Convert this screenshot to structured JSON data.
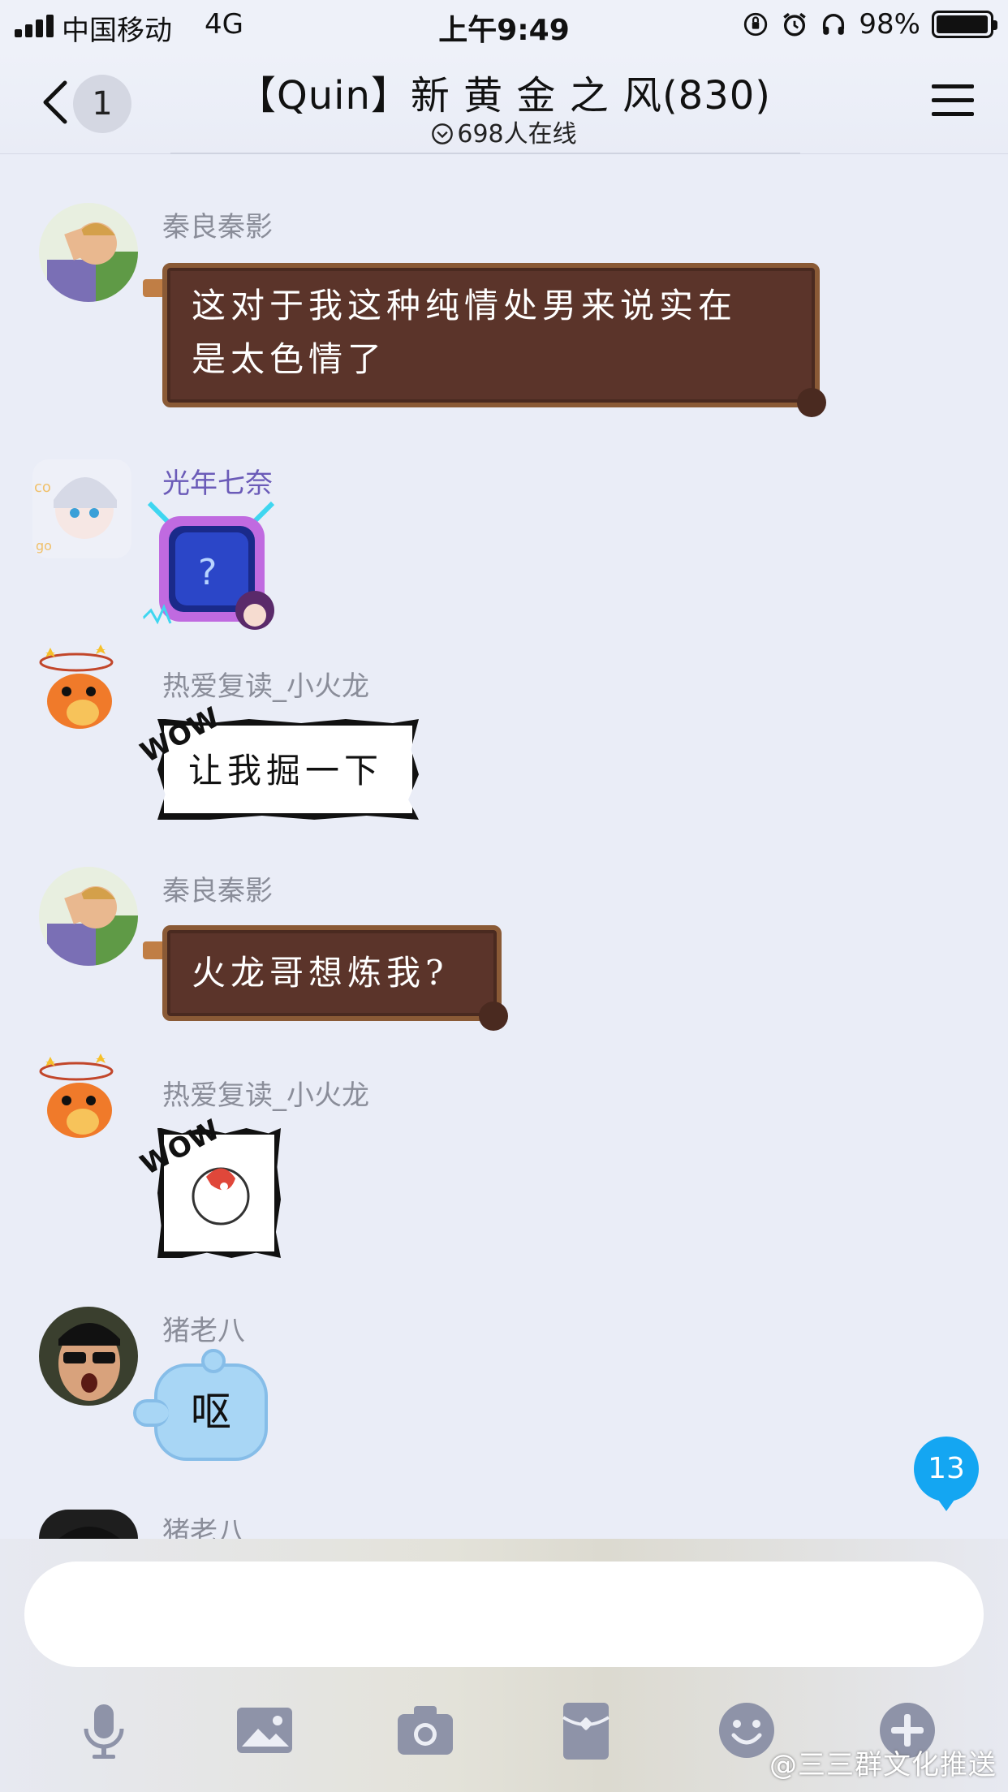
{
  "status_bar": {
    "carrier": "中国移动",
    "network": "4G",
    "time": "上午9:49",
    "battery": "98%",
    "battery_level": 0.98
  },
  "nav": {
    "unread_count": "1",
    "title": "【Quin】新 黄 金 之 风(830)",
    "online": "698人在线"
  },
  "messages": [
    {
      "sender": "秦良秦影",
      "line1": "这对于我这种纯情处男来说实在",
      "line2": "是太色情了"
    },
    {
      "sender": "光年七奈",
      "sticker": "?"
    },
    {
      "sender": "热爱复读_小火龙",
      "text": "让我掘一下",
      "tag": "WOW"
    },
    {
      "sender": "秦良秦影",
      "text": "火龙哥想炼我?"
    },
    {
      "sender": "热爱复读_小火龙",
      "tag": "WOW"
    },
    {
      "sender": "猪老八",
      "text": "呕"
    },
    {
      "sender": "猪老八"
    }
  ],
  "unread_badge": "13",
  "input": {
    "placeholder": ""
  },
  "watermark": "@三三群文化推送",
  "colors": {
    "background": "#eaedf7",
    "scroll_bubble": "#5b342a",
    "badge": "#14a6f2",
    "icon": "#8e93a8"
  },
  "icons": [
    "microphone-icon",
    "image-icon",
    "camera-icon",
    "red-packet-icon",
    "emoji-icon",
    "plus-icon"
  ]
}
